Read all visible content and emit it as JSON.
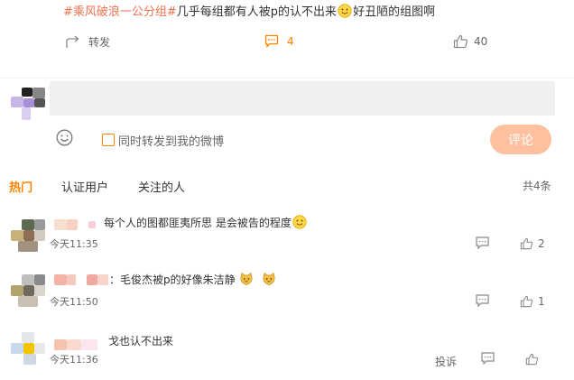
{
  "post": {
    "hashtag": "#乘风破浪一公分组#",
    "text_before_emoji": "几乎每组都有人被p的认不出来",
    "text_after_emoji": "好丑陋的组图啊",
    "emoji_icon": "smile-emoji",
    "repost_label": "转发",
    "comment_count": "4",
    "like_count": "40"
  },
  "composer": {
    "placeholder": "",
    "checkbox_label": "同时转发到我的微博",
    "submit_label": "评论"
  },
  "tabs": [
    {
      "label": "热门",
      "active": true
    },
    {
      "label": "认证用户",
      "active": false
    },
    {
      "label": "关注的人",
      "active": false
    }
  ],
  "total_label": "共4条",
  "comments": [
    {
      "text": "每个人的图都匪夷所思 是会被告的程度",
      "time": "今天11:35",
      "likes": "2"
    },
    {
      "text": "：毛俊杰被p的好像朱洁静",
      "time": "今天11:50",
      "likes": "1"
    },
    {
      "text": "戈也认不出来",
      "time": "今天11:36",
      "report_label": "投诉",
      "likes": ""
    }
  ],
  "colors": {
    "accent": "#ff8200",
    "hashtag": "#eb7350",
    "button_disabled": "#ffc09f"
  }
}
